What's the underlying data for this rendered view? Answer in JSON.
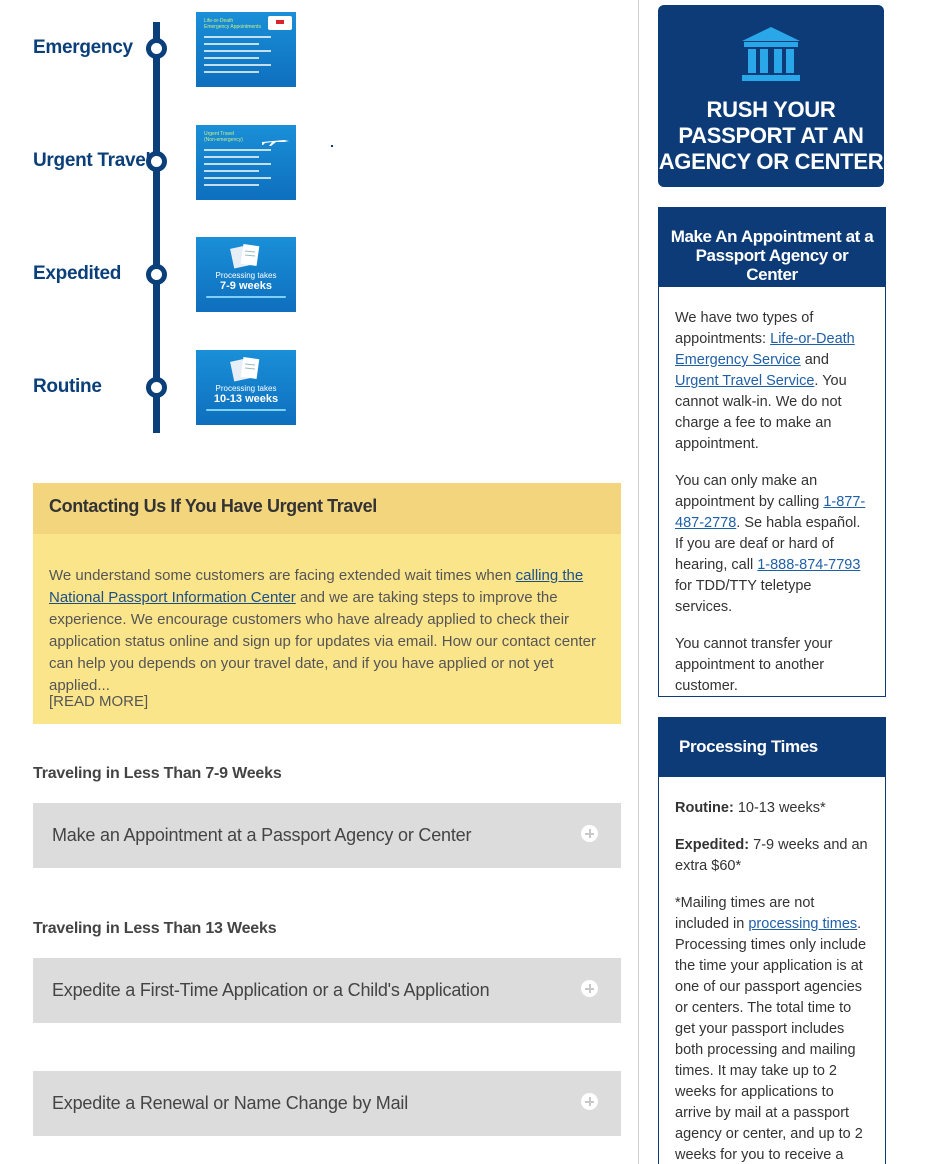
{
  "timeline": {
    "items": [
      {
        "label": "Emergency",
        "card": {
          "title": "Life-or-Death\nEmergency Appointments"
        }
      },
      {
        "label": "Urgent Travel",
        "card": {
          "title": "Urgent Travel\n(Non-emergency)"
        }
      },
      {
        "label": "Expedited",
        "card": {
          "line1": "Processing takes",
          "line2": "7-9 weeks"
        }
      },
      {
        "label": "Routine",
        "card": {
          "line1": "Processing takes",
          "line2": "10-13 weeks"
        }
      }
    ]
  },
  "urgent_box": {
    "title": "Contacting Us If You Have Urgent Travel",
    "body_before_link": "We understand some customers are facing extended wait times when ",
    "link": "calling the National Passport Information Center",
    "body_after_link": " and we are taking steps to improve the experience. We encourage customers who have already applied to check their application status online and sign up for updates via email. How our contact center can help you depends on your travel date, and if you have applied or not yet applied...",
    "read_more": "[READ MORE]"
  },
  "sections": [
    {
      "heading": "Traveling in Less Than 7-9 Weeks",
      "accordions": [
        "Make an Appointment at a Passport Agency or Center"
      ]
    },
    {
      "heading": "Traveling in Less Than 13 Weeks",
      "accordions": [
        "Expedite a First-Time Application or a Child's Application",
        "Expedite a Renewal or Name Change by Mail"
      ]
    }
  ],
  "rush": {
    "text": "RUSH YOUR PASSPORT AT AN AGENCY OR CENTER",
    "icon": "bank-icon"
  },
  "appointment_panel": {
    "title": "Make An Appointment at a Passport Agency or Center",
    "p1_a": "We have two types of appointments: ",
    "p1_link1": "Life-or-Death Emergency Service",
    "p1_b": " and ",
    "p1_link2": "Urgent Travel Service",
    "p1_c": ". You cannot walk-in. We do not charge a fee to make an appointment.",
    "p2_a": "You can only make an appointment by calling ",
    "p2_phone1": "1-877-487-2778",
    "p2_b": ". Se habla español. If you are deaf or hard of hearing, call ",
    "p2_phone2": "1-888-874-7793",
    "p2_c": " for TDD/TTY teletype services.",
    "p3": "You cannot transfer your appointment to another customer."
  },
  "processing_panel": {
    "title": "Processing Times",
    "routine_label": "Routine:",
    "routine_value": " 10-13 weeks*",
    "expedited_label": "Expedited:",
    "expedited_value": " 7-9 weeks and an extra $60*",
    "note_a": "*Mailing times are not included in ",
    "note_link": "processing times",
    "note_b": ". Processing times only include the time your application is at one of our passport agencies or centers. The total time to get your passport includes both processing and mailing times. It may take up to 2 weeks for applications to arrive by mail at a passport agency or center, and up to 2 weeks for you to receive a"
  },
  "colors": {
    "navy": "#0b3f7a",
    "yellow": "#fbe58b",
    "yellow_header": "#f3d57e",
    "gray": "#dcdcdc",
    "card_blue": "#1a8fd8"
  }
}
